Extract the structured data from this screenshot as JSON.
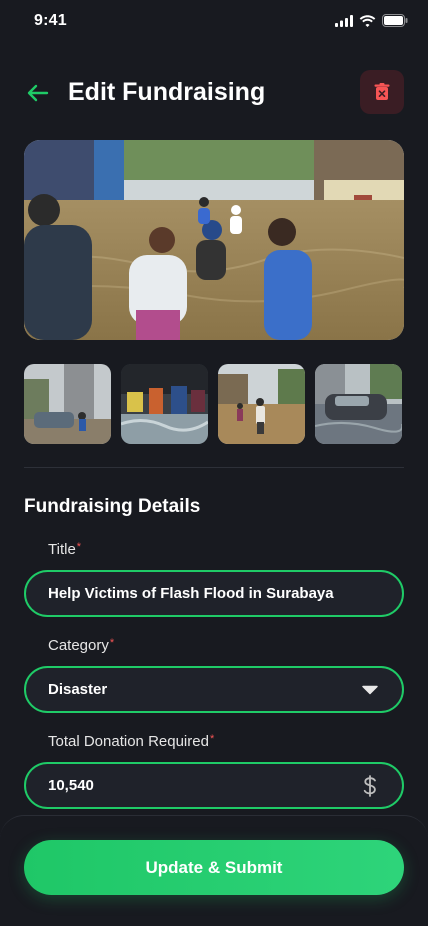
{
  "status_bar": {
    "time": "9:41"
  },
  "header": {
    "title": "Edit Fundraising"
  },
  "images": {
    "hero_alt": "flood-scene-people-wading",
    "thumbnails": [
      "flood-rescue-street",
      "flood-feet-in-water",
      "flood-street-crowd",
      "flood-car-submerged"
    ]
  },
  "details": {
    "section_title": "Fundraising Details",
    "title_label": "Title",
    "title_value": "Help Victims of Flash Flood in Surabaya",
    "category_label": "Category",
    "category_value": "Disaster",
    "donation_label": "Total Donation Required",
    "donation_value": "10,540",
    "required_marker": "*"
  },
  "actions": {
    "submit_label": "Update & Submit"
  },
  "colors": {
    "background": "#181a20",
    "accent_green": "#1fcb67",
    "danger_red": "#f75555",
    "field_bg": "#1f222a"
  }
}
